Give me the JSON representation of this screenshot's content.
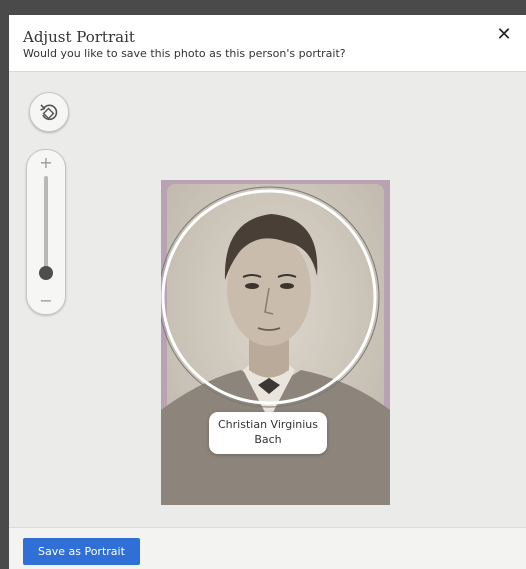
{
  "dialog": {
    "title": "Adjust Portrait",
    "subtitle": "Would you like to save this photo as this person's portrait?",
    "close_label": "✕"
  },
  "controls": {
    "rotate_icon": "rotate-left-icon",
    "zoom_in_label": "+",
    "zoom_out_label": "−",
    "zoom_level": 0
  },
  "photo": {
    "person_name_line1": "Christian Virginius",
    "person_name_line2": "Bach"
  },
  "footer": {
    "save_label": "Save as Portrait"
  },
  "colors": {
    "primary_button": "#2f6fd6",
    "stage_background": "#ebebea"
  }
}
